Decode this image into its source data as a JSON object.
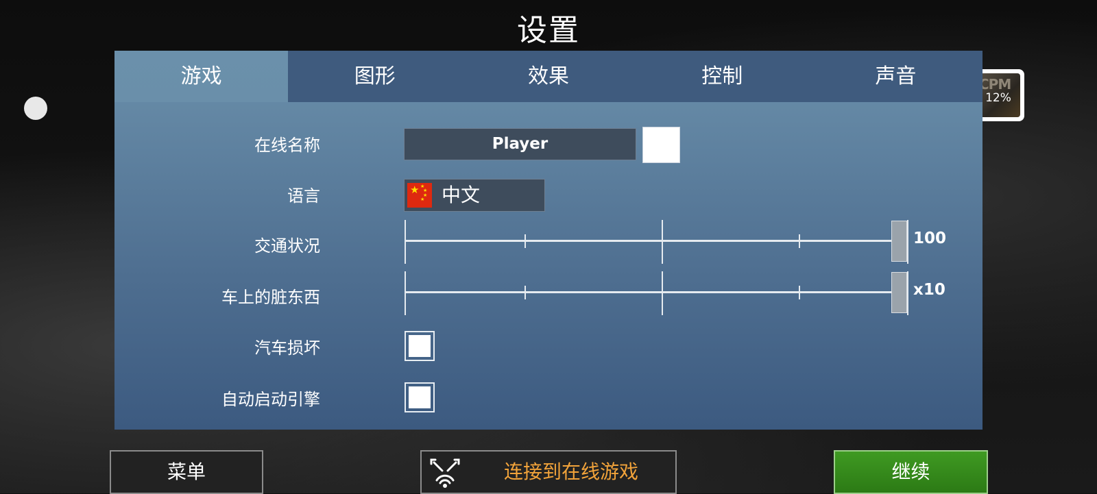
{
  "title": "设置",
  "overlay": {
    "progress_text": "12%",
    "logo_text": "CPM"
  },
  "tabs": [
    {
      "label": "游戏",
      "active": true
    },
    {
      "label": "图形",
      "active": false
    },
    {
      "label": "效果",
      "active": false
    },
    {
      "label": "控制",
      "active": false
    },
    {
      "label": "声音",
      "active": false
    }
  ],
  "settings": {
    "online_name": {
      "label": "在线名称",
      "value": "Player",
      "color": "#ffffff"
    },
    "language": {
      "label": "语言",
      "value": "中文",
      "flag": "cn-flag-icon"
    },
    "traffic": {
      "label": "交通状况",
      "value": "100",
      "level": 1.0
    },
    "dirt": {
      "label": "车上的脏东西",
      "value": "x10",
      "level": 1.0
    },
    "car_damage": {
      "label": "汽车损坏",
      "checked": false
    },
    "auto_start": {
      "label": "自动启动引擎",
      "checked": false
    }
  },
  "buttons": {
    "menu": "菜单",
    "online": "连接到在线游戏",
    "continue": "继续"
  },
  "colors": {
    "panel": "#5f82a0",
    "tab_inactive": "#3f5b7e",
    "online_text": "#f2a33a",
    "continue": "#3f9a22"
  }
}
